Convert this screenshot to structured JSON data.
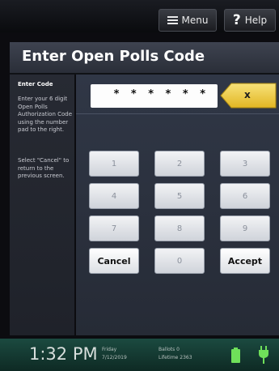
{
  "header": {
    "menu_label": "Menu",
    "help_label": "Help"
  },
  "title": "Enter Open Polls Code",
  "instructions": {
    "heading": "Enter Code",
    "text1": "Enter your 6 digit Open Polls Authorization Code using the number pad to the right.",
    "text2": "Select \"Cancel\" to return to the previous screen."
  },
  "code_field": {
    "value": "* * * * * *"
  },
  "clear_button": {
    "label": "x"
  },
  "keypad": {
    "keys": [
      "1",
      "2",
      "3",
      "4",
      "5",
      "6",
      "7",
      "8",
      "9"
    ],
    "cancel": "Cancel",
    "zero": "0",
    "accept": "Accept"
  },
  "status": {
    "time": "1:32 PM",
    "day": "Friday",
    "date": "7/12/2019",
    "ballots": "Ballots    0",
    "lifetime": "Lifetime  2363"
  },
  "colors": {
    "battery": "#6fe05a",
    "plug": "#6fe05a",
    "clear_button": "#f1cf3a"
  }
}
